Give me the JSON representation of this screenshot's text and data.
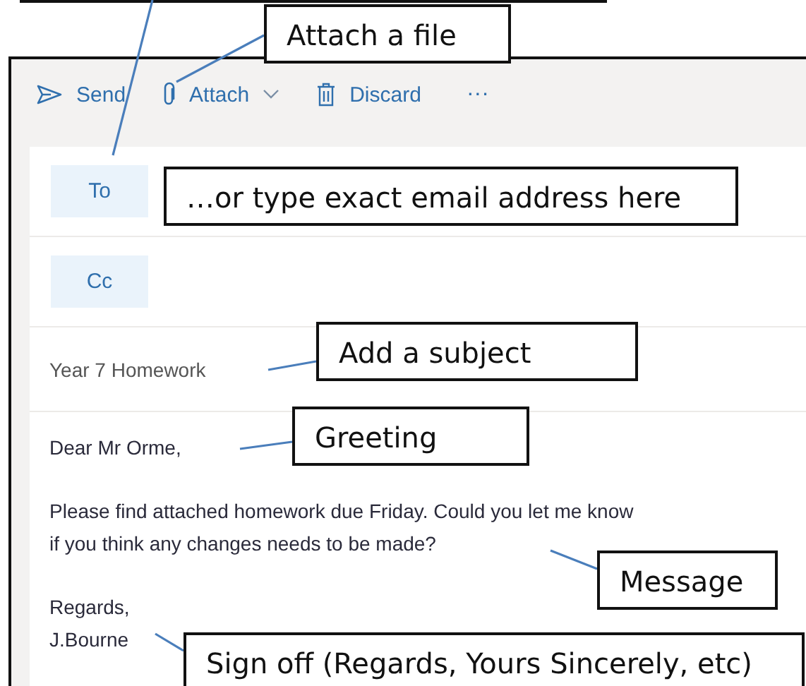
{
  "toolbar": {
    "buttons": [
      {
        "kind": "send",
        "label": "Send",
        "dropdown": false
      },
      {
        "kind": "attach",
        "label": "Attach",
        "dropdown": true
      },
      {
        "kind": "discard",
        "label": "Discard",
        "dropdown": false
      }
    ],
    "more": "···"
  },
  "recipients": [
    {
      "label": "To"
    },
    {
      "label": "Cc"
    }
  ],
  "subject": {
    "value": "Year 7 Homework"
  },
  "body": {
    "greeting": "Dear Mr Orme,",
    "message_lines": [
      "Please find attached homework due Friday. Could you let me know",
      "if you think any changes needs to be made?"
    ],
    "sign_off_lines": [
      "Regards,",
      "J.Bourne"
    ]
  },
  "annotations": [
    {
      "kind": "to"
    },
    {
      "kind": "attach",
      "text": "Attach a file"
    },
    {
      "kind": "address",
      "text": "…or type exact email address here"
    },
    {
      "kind": "subject",
      "text": "Add a subject"
    },
    {
      "kind": "greeting",
      "text": "Greeting"
    },
    {
      "kind": "message",
      "text": "Message"
    },
    {
      "kind": "signoff",
      "text": "Sign off (Regards, Yours Sincerely, etc)"
    }
  ]
}
